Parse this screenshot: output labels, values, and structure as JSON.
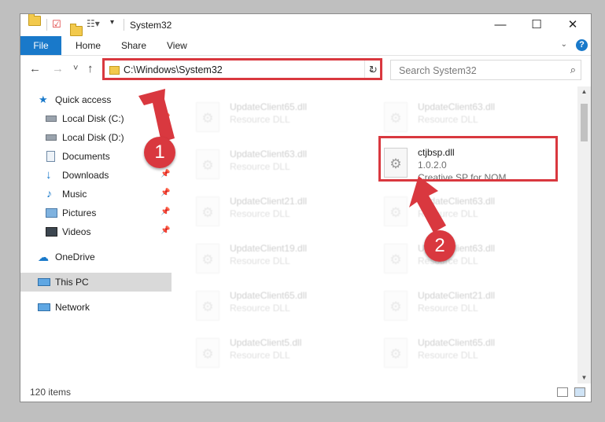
{
  "window": {
    "title": "System32",
    "controls": {
      "minimize": "—",
      "maximize": "☐",
      "close": "✕"
    }
  },
  "ribbon": {
    "tabs": [
      "File",
      "Home",
      "Share",
      "View"
    ],
    "expand_icon": "chevron-down-icon",
    "help_label": "?"
  },
  "nav": {
    "back": "←",
    "forward": "→",
    "recent": "˅",
    "up": "↑",
    "address": "C:\\Windows\\System32",
    "refresh": "↻",
    "search_placeholder": "Search System32"
  },
  "sidebar": {
    "items": [
      {
        "label": "Quick access",
        "icon": "star-icon"
      },
      {
        "label": "Local Disk (C:)",
        "icon": "drive-icon",
        "pinned": true
      },
      {
        "label": "Local Disk (D:)",
        "icon": "drive-icon",
        "pinned": true
      },
      {
        "label": "Documents",
        "icon": "documents-icon",
        "pinned": true
      },
      {
        "label": "Downloads",
        "icon": "download-icon",
        "pinned": true
      },
      {
        "label": "Music",
        "icon": "music-icon",
        "pinned": true
      },
      {
        "label": "Pictures",
        "icon": "pictures-icon",
        "pinned": true
      },
      {
        "label": "Videos",
        "icon": "videos-icon",
        "pinned": true
      },
      {
        "label": "OneDrive",
        "icon": "cloud-icon"
      },
      {
        "label": "This PC",
        "icon": "computer-icon",
        "selected": true
      },
      {
        "label": "Network",
        "icon": "network-icon"
      }
    ]
  },
  "files": {
    "highlighted": {
      "name": "ctjbsp.dll",
      "version": "1.0.2.0",
      "description": "Creative SP for NOM..."
    },
    "faded": [
      {
        "name": "UpdateClient65.dll",
        "type": "Resource DLL"
      },
      {
        "name": "UpdateClient63.dll",
        "type": "Resource DLL"
      },
      {
        "name": "UpdateClient63.dll",
        "type": "Resource DLL"
      },
      {
        "name": "UpdateClient21.dll",
        "type": "Resource DLL"
      },
      {
        "name": "UpdateClient63.dll",
        "type": "Resource DLL"
      },
      {
        "name": "UpdateClient19.dll",
        "type": "Resource DLL"
      },
      {
        "name": "UpdateClient63.dll",
        "type": "Resource DLL"
      },
      {
        "name": "UpdateClient65.dll",
        "type": "Resource DLL"
      },
      {
        "name": "UpdateClient21.dll",
        "type": "Resource DLL"
      },
      {
        "name": "UpdateClient5.dll",
        "type": "Resource DLL"
      },
      {
        "name": "UpdateClient65.dll",
        "type": "Resource DLL"
      }
    ]
  },
  "status": {
    "items_count": "120 items"
  },
  "annotations": {
    "step1": "1",
    "step2": "2",
    "color": "#d9383f"
  }
}
